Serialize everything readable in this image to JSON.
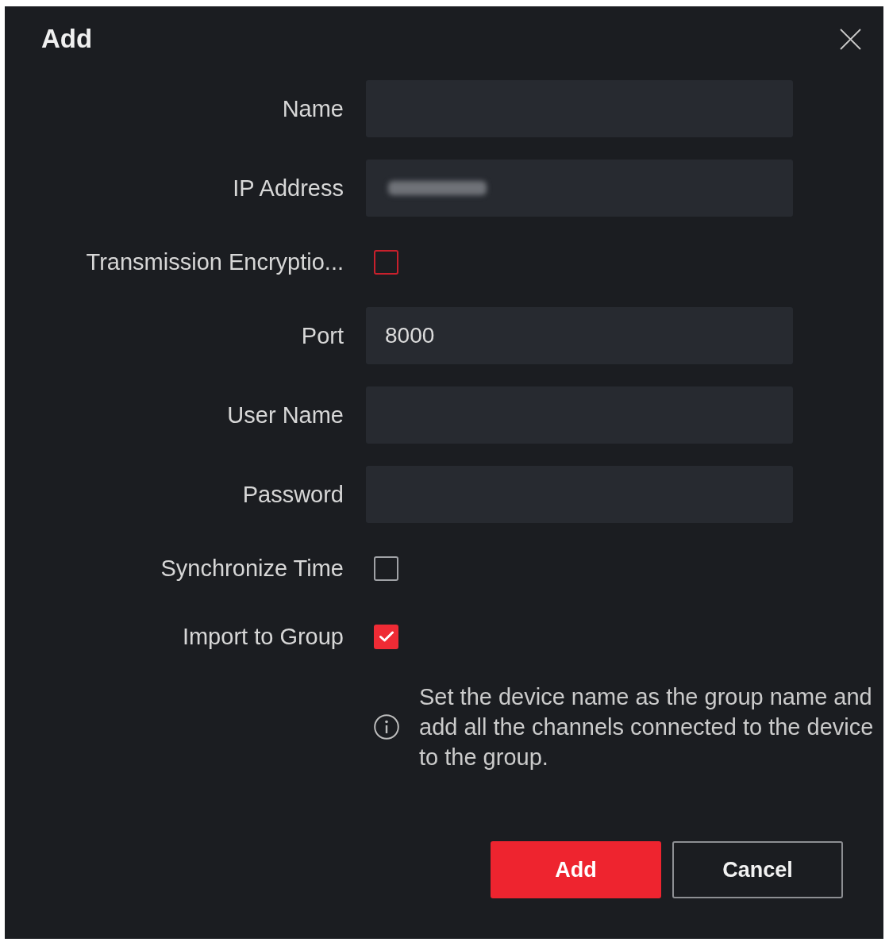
{
  "dialog": {
    "title": "Add"
  },
  "fields": [
    {
      "kind": "text",
      "label": "Name"
    },
    {
      "kind": "text",
      "label": "IP Address",
      "value_blurred": true
    },
    {
      "kind": "checkbox",
      "label": "Transmission Encryptio...",
      "checked": false,
      "color": "#c8202c"
    },
    {
      "kind": "text",
      "label": "Port",
      "value": "8000"
    },
    {
      "kind": "text",
      "label": "User Name"
    },
    {
      "kind": "text",
      "label": "Password"
    },
    {
      "kind": "checkbox",
      "label": "Synchronize Time",
      "checked": false,
      "color": "#a0a2a6"
    },
    {
      "kind": "checkbox",
      "label": "Import to Group",
      "checked": true,
      "color": "#ef2b35"
    }
  ],
  "note": {
    "text": "Set the device name as the group name and add all the channels connected to the device to the group."
  },
  "buttons": [
    {
      "kind": "primary",
      "label": "Add"
    },
    {
      "kind": "secondary",
      "label": "Cancel"
    }
  ]
}
